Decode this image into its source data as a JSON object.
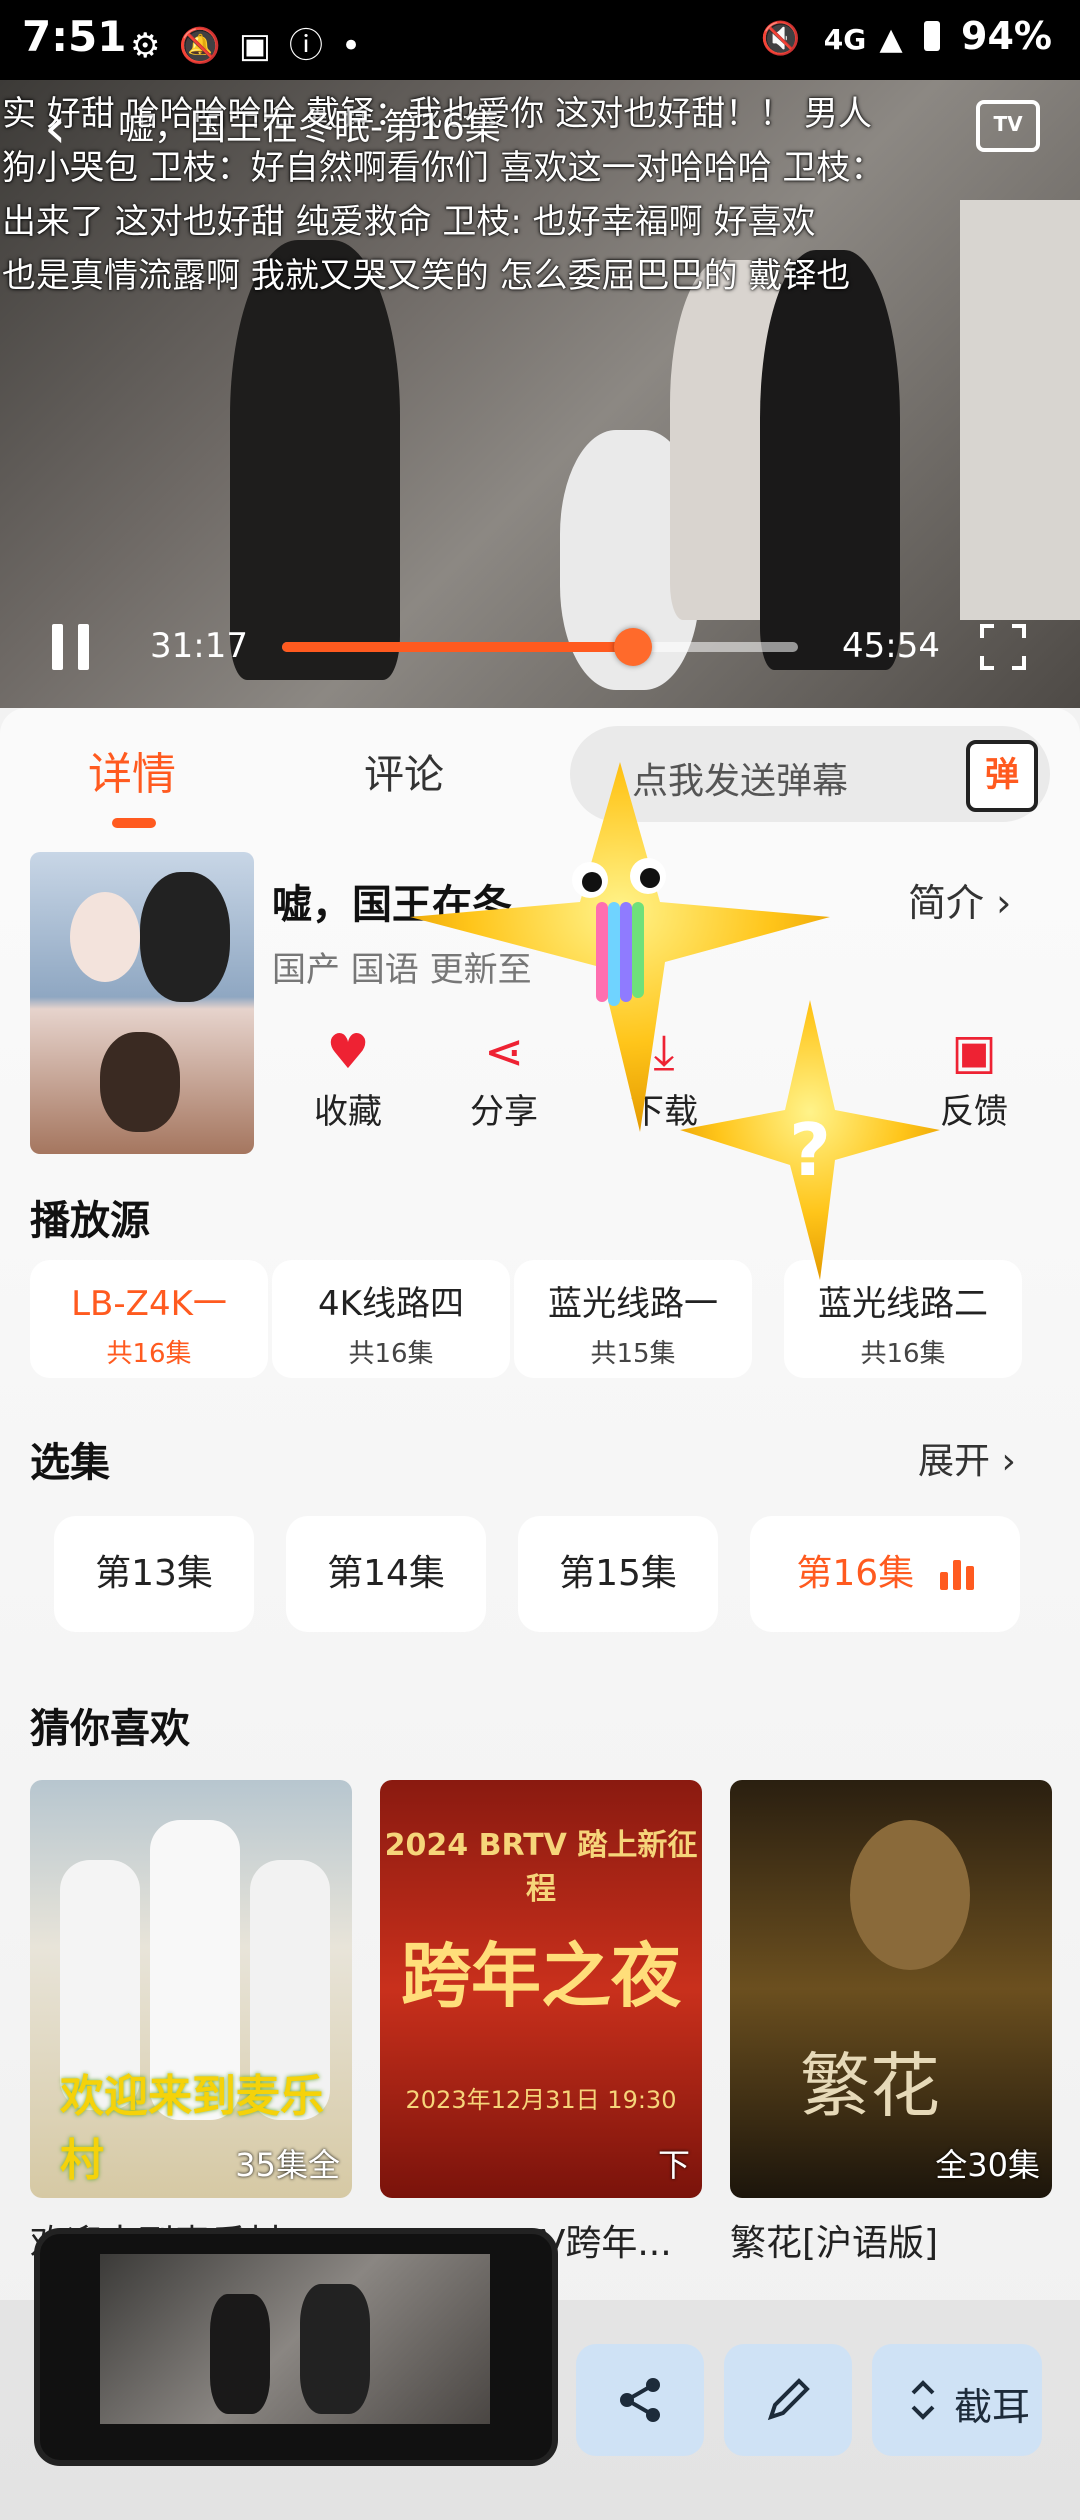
{
  "status_bar": {
    "time": "7:51",
    "left_icons": [
      "gear-icon",
      "no-bell-icon",
      "app-icon",
      "info-icon",
      "dot-icon"
    ],
    "right_text": "94%",
    "network": "4G"
  },
  "player": {
    "title": "嘘，国王在冬眠-第16集",
    "current_time": "31:17",
    "total_time": "45:54",
    "progress": 0.68,
    "tv_label": "TV",
    "danmaku": [
      "实 好甜    哈哈哈哈哈   戴铎：我也爱你   这对也好甜！！   男人",
      "狗小哭包   卫枝：好自然啊看你们        喜欢这一对哈哈哈   卫枝：",
      "出来了      这对也好甜 纯爱救命        卫枝: 也好幸福啊          好喜欢",
      "也是真情流露啊                我就又哭又笑的   怎么委屈巴巴的      戴铎也"
    ]
  },
  "tabs": {
    "details": "详情",
    "comments": "评论",
    "danmaku_placeholder": "点我发送弹幕",
    "danmaku_button": "弹"
  },
  "show": {
    "title": "嘘，国王在冬",
    "meta": "国产 国语 更新至",
    "intro_label": "简介 ›",
    "actions": [
      {
        "label": "收藏",
        "icon": "heart-icon"
      },
      {
        "label": "分享",
        "icon": "share-icon"
      },
      {
        "label": "下载",
        "icon": "download-icon"
      },
      {
        "label": "反馈",
        "icon": "feedback-icon"
      }
    ]
  },
  "sources": {
    "title": "播放源",
    "items": [
      {
        "name": "LB-Z4K一",
        "count": "共16集",
        "active": true
      },
      {
        "name": "4K线路四",
        "count": "共16集",
        "active": false
      },
      {
        "name": "蓝光线路一",
        "count": "共15集",
        "active": false
      },
      {
        "name": "蓝光线路二",
        "count": "共16集",
        "active": false
      }
    ]
  },
  "episodes": {
    "title": "选集",
    "expand_label": "展开 ›",
    "items": [
      "第13集",
      "第14集",
      "第15集",
      "第16集"
    ],
    "active_index": 3
  },
  "recommend": {
    "title": "猜你喜欢",
    "items": [
      {
        "title": "欢迎来到麦乐村",
        "badge": "35集全",
        "poster_text": "欢迎来到麦乐村"
      },
      {
        "title": "2024BRTV跨年...",
        "badge": "下",
        "poster_text": "跨年之夜",
        "poster_sub": "2024 BRTV 踏上新征程",
        "poster_date": "2023年12月31日 19:30"
      },
      {
        "title": "繁花[沪语版]",
        "badge": "全30集",
        "poster_text": "繁花"
      }
    ]
  },
  "overlay": {
    "screenshot_button": "截耳"
  },
  "colors": {
    "accent": "#ff5a1f",
    "fab_bg": "#cfe2f5"
  }
}
